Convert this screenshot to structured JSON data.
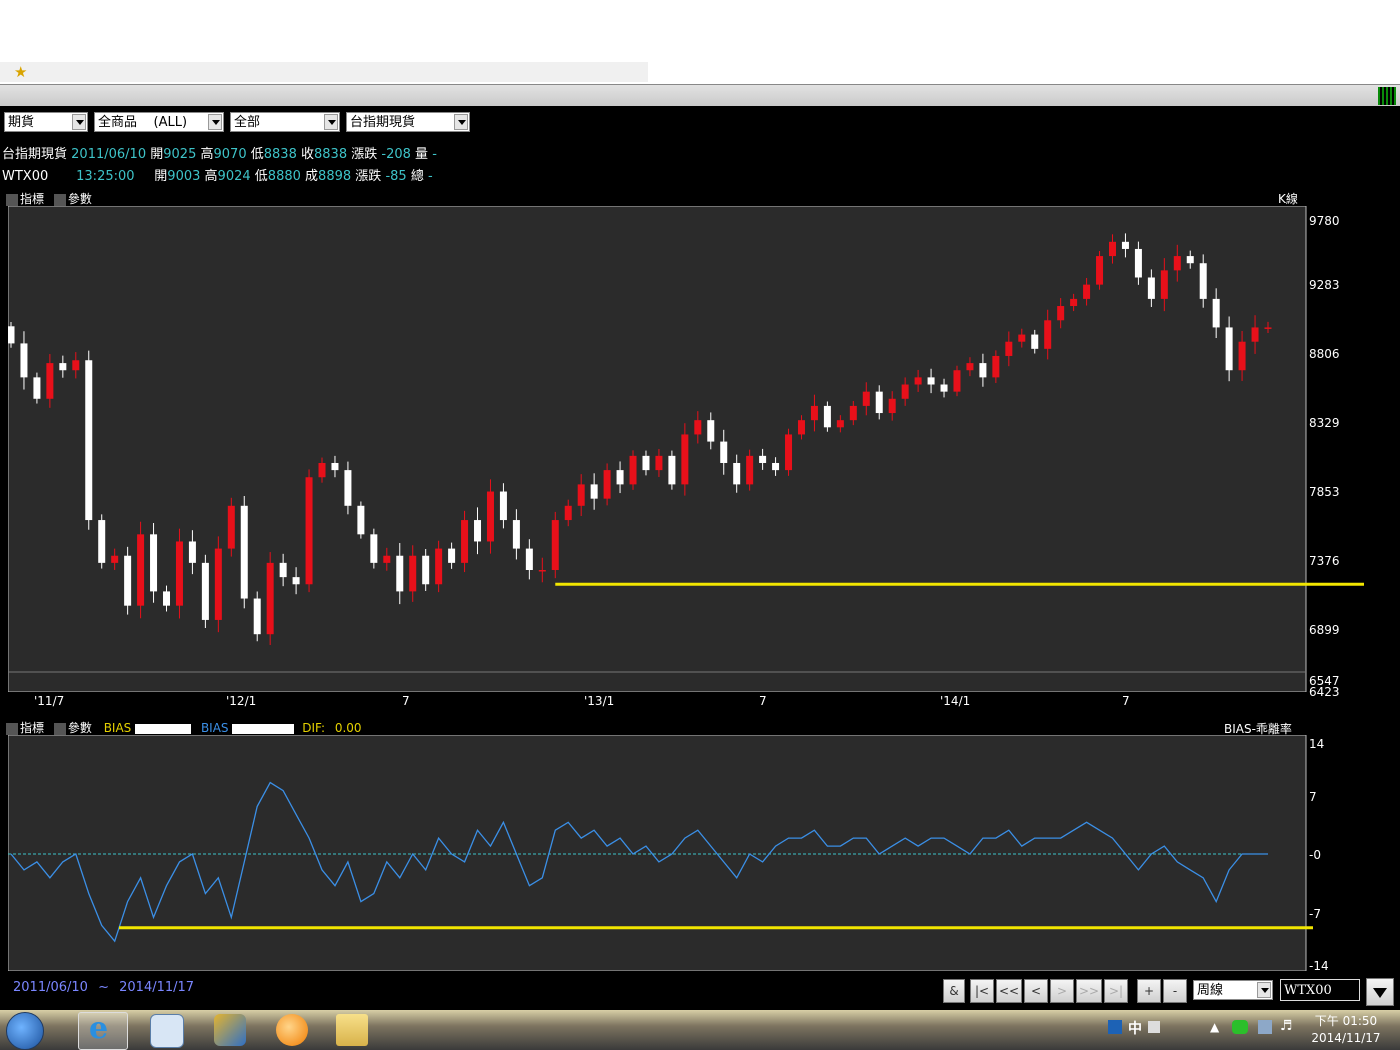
{
  "favorites_icon": "star-icon",
  "toolbar": {
    "selects": [
      "期貨",
      "全商品    (ALL)",
      "全部",
      "台指期現貨"
    ]
  },
  "quote": {
    "row1": {
      "name": "台指期現貨",
      "date": "2011/06/10",
      "open_label": "開",
      "open": "9025",
      "high_label": "高",
      "high": "9070",
      "low_label": "低",
      "low": "8838",
      "close_label": "收",
      "close": "8838",
      "change_label": "漲跌",
      "change": "-208",
      "vol_label": "量",
      "vol": "-"
    },
    "row2": {
      "name": "WTX00",
      "time": "13:25:00",
      "open_label": "開",
      "open": "9003",
      "high_label": "高",
      "high": "9024",
      "low_label": "低",
      "low": "8880",
      "close_label": "成",
      "close": "8898",
      "change_label": "漲跌",
      "change": "-85",
      "vol_label": "總",
      "vol": "-"
    }
  },
  "main_panel": {
    "indicator_label": "指標",
    "param_label": "參數",
    "chart_title": "K線",
    "y_ticks": [
      "9780",
      "9283",
      "8806",
      "8329",
      "7853",
      "7376",
      "6899",
      "6547",
      "6423"
    ],
    "x_ticks": [
      "'11/7",
      "'12/1",
      "7",
      "'13/1",
      "7",
      "'14/1",
      "7"
    ]
  },
  "sub_panel": {
    "indicator_label": "指標",
    "param_label": "參數",
    "bias1_label": "BIAS",
    "bias2_label": "BIAS",
    "dif_label": "DIF:",
    "dif_value": "0.00",
    "chart_title": "BIAS-乖離率",
    "y_ticks": [
      "14",
      "7",
      "-0",
      "-7",
      "-14"
    ]
  },
  "footer": {
    "date_start": "2011/06/10",
    "tilde": "~",
    "date_end": "2014/11/17",
    "nav_buttons": [
      "&",
      "|<",
      "<<",
      "<",
      ">",
      ">>",
      ">|",
      "+",
      "-"
    ],
    "period_select": "周線",
    "symbol_input": "WTX00"
  },
  "taskbar": {
    "clock_time": "下午 01:50",
    "clock_date": "2014/11/17",
    "ime_label": "中"
  },
  "colors": {
    "up": "#e8101a",
    "down": "#ffffff",
    "bias_line": "#3b8fe6",
    "support_line": "#f2e600",
    "panel_bg": "#2b2b2b"
  },
  "chart_data": [
    {
      "type": "candlestick",
      "title": "K線",
      "period": "weekly",
      "symbol": "WTX00",
      "ylim": [
        6423,
        9780
      ],
      "x_ticks": [
        "'11/7",
        "'12/1",
        "7",
        "'13/1",
        "7",
        "'14/1",
        "7"
      ],
      "close_trend": [
        8838,
        8600,
        8450,
        8700,
        8650,
        8720,
        7600,
        7300,
        7350,
        7000,
        7500,
        7100,
        7000,
        7450,
        7300,
        6900,
        7400,
        7700,
        7050,
        6800,
        7300,
        7200,
        7150,
        7900,
        8000,
        7950,
        7700,
        7500,
        7300,
        7350,
        7100,
        7350,
        7150,
        7400,
        7300,
        7600,
        7450,
        7800,
        7600,
        7400,
        7250,
        7250,
        7600,
        7700,
        7850,
        7750,
        7950,
        7850,
        8050,
        7950,
        8050,
        7850,
        8200,
        8300,
        8150,
        8000,
        7850,
        8050,
        8000,
        7950,
        8200,
        8300,
        8400,
        8250,
        8300,
        8400,
        8500,
        8350,
        8450,
        8550,
        8600,
        8550,
        8500,
        8650,
        8700,
        8600,
        8750,
        8850,
        8900,
        8800,
        9000,
        9100,
        9150,
        9250,
        9450,
        9550,
        9500,
        9300,
        9150,
        9350,
        9450,
        9400,
        9150,
        8950,
        8650,
        8850,
        8950,
        8950
      ],
      "support_line": 7150
    },
    {
      "type": "line",
      "title": "BIAS-乖離率",
      "ylim": [
        -14,
        14
      ],
      "y_ticks": [
        14,
        7,
        0,
        -7,
        -14
      ],
      "series": [
        {
          "name": "BIAS",
          "values": [
            0,
            -2,
            -1,
            -3,
            -1,
            0,
            -5,
            -9,
            -11,
            -6,
            -3,
            -8,
            -4,
            -1,
            0,
            -5,
            -3,
            -8,
            -1,
            6,
            9,
            8,
            5,
            2,
            -2,
            -4,
            -1,
            -6,
            -5,
            -1,
            -3,
            0,
            -2,
            2,
            0,
            -1,
            3,
            1,
            4,
            0,
            -4,
            -3,
            3,
            4,
            2,
            3,
            1,
            2,
            0,
            1,
            -1,
            0,
            2,
            3,
            1,
            -1,
            -3,
            0,
            -1,
            1,
            2,
            2,
            3,
            1,
            1,
            2,
            2,
            0,
            1,
            2,
            1,
            2,
            2,
            1,
            0,
            2,
            2,
            3,
            1,
            2,
            2,
            2,
            3,
            4,
            3,
            2,
            0,
            -2,
            0,
            1,
            -1,
            -2,
            -3,
            -6,
            -2,
            0,
            0,
            0
          ]
        }
      ],
      "reference_line": 0,
      "support_line": -9.3
    }
  ]
}
